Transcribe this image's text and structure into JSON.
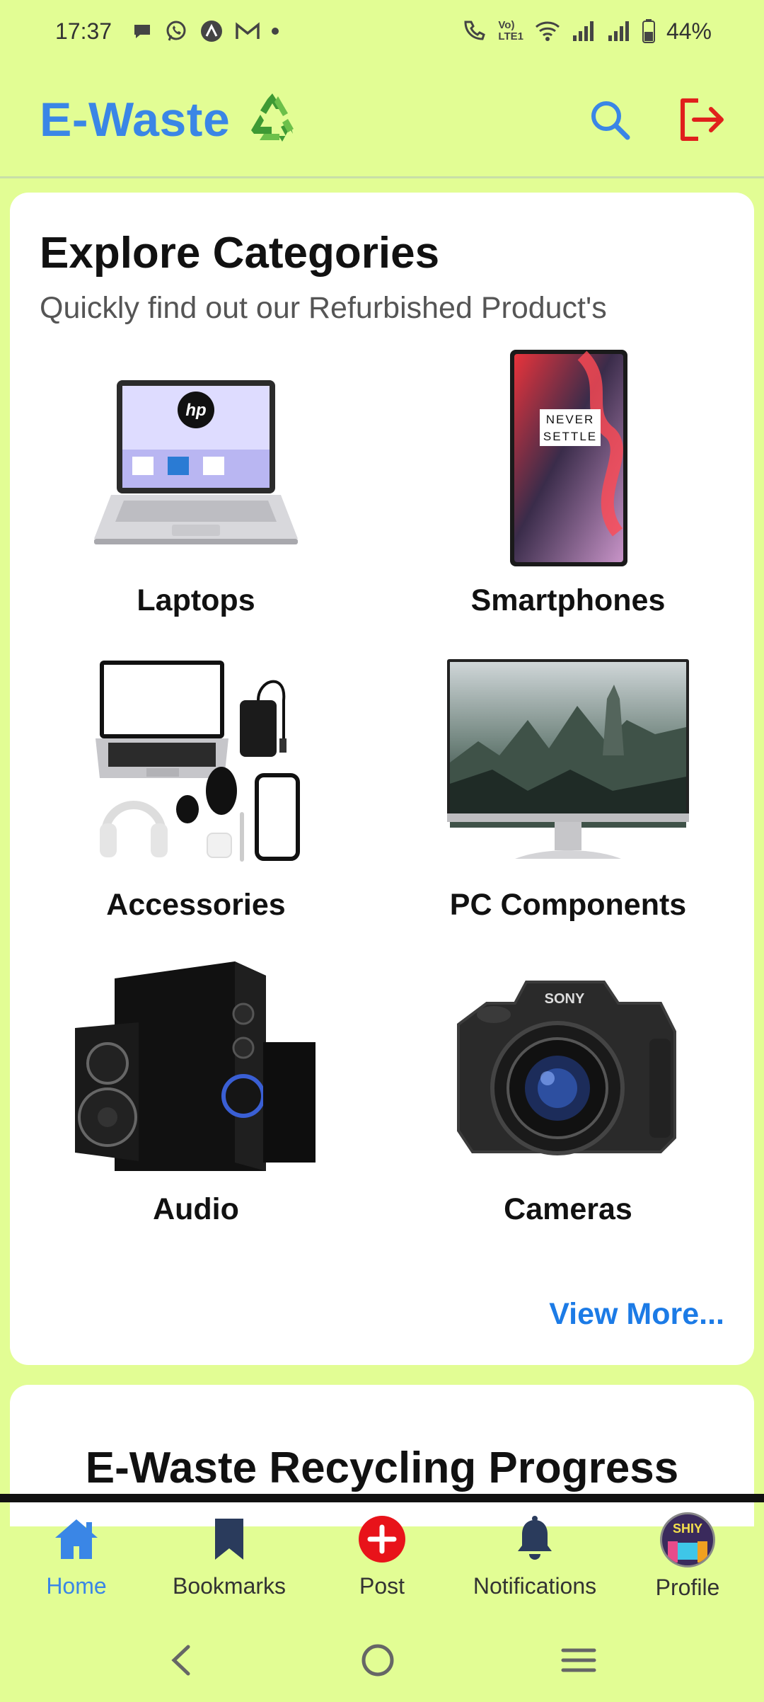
{
  "status_bar": {
    "time": "17:37",
    "battery": "44%",
    "volte_label_1": "Vo)",
    "volte_label_2": "LTE1"
  },
  "app_bar": {
    "title": "E-Waste",
    "logo_icon": "recycle-icon",
    "search_icon": "search-icon",
    "logout_icon": "logout-icon",
    "accent": "#3a86e6",
    "logout_color": "#e0201c"
  },
  "categories": {
    "title": "Explore Categories",
    "subtitle": "Quickly find out our Refurbished Product's",
    "items": [
      {
        "label": "Laptops"
      },
      {
        "label": "Smartphones"
      },
      {
        "label": "Accessories"
      },
      {
        "label": "PC Components"
      },
      {
        "label": "Audio"
      },
      {
        "label": "Cameras"
      }
    ],
    "view_more": "View More..."
  },
  "progress": {
    "title": "E-Waste Recycling Progress"
  },
  "bottom_nav": {
    "items": [
      {
        "label": "Home",
        "icon": "home-icon",
        "active": true
      },
      {
        "label": "Bookmarks",
        "icon": "bookmark-icon",
        "active": false
      },
      {
        "label": "Post",
        "icon": "plus-icon",
        "active": false
      },
      {
        "label": "Notifications",
        "icon": "bell-icon",
        "active": false
      },
      {
        "label": "Profile",
        "icon": "avatar",
        "active": false
      }
    ],
    "avatar_text": "SHIY"
  },
  "colors": {
    "background": "#e2fd94",
    "card": "#ffffff",
    "link": "#1c7be6",
    "post_button": "#e8131a"
  }
}
